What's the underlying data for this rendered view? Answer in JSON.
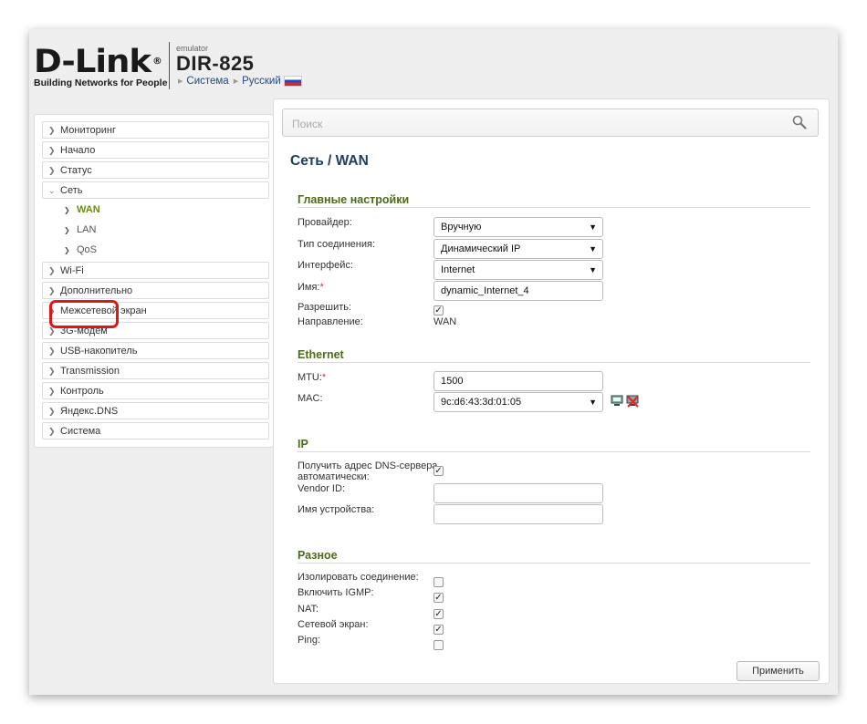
{
  "header": {
    "brand": "D-Link",
    "registered": "®",
    "tagline": "Building Networks for People",
    "emulator": "emulator",
    "model": "DIR-825",
    "crumb_system": "Система",
    "crumb_language": "Русский"
  },
  "sidebar": {
    "items": [
      {
        "label": "Мониторинг"
      },
      {
        "label": "Начало"
      },
      {
        "label": "Статус"
      },
      {
        "label": "Сеть"
      },
      {
        "label": "Wi-Fi"
      },
      {
        "label": "Дополнительно"
      },
      {
        "label": "Межсетевой экран"
      },
      {
        "label": "3G-модем"
      },
      {
        "label": "USB-накопитель"
      },
      {
        "label": "Transmission"
      },
      {
        "label": "Контроль"
      },
      {
        "label": "Яндекс.DNS"
      },
      {
        "label": "Система"
      }
    ],
    "sub_items": [
      {
        "label": "WAN"
      },
      {
        "label": "LAN"
      },
      {
        "label": "QoS"
      }
    ]
  },
  "search": {
    "placeholder": "Поиск"
  },
  "page": {
    "title": "Сеть /  WAN",
    "sections": {
      "main": "Главные настройки",
      "ethernet": "Ethernet",
      "ip": "IP",
      "misc": "Разное"
    },
    "main": {
      "provider_label": "Провайдер:",
      "provider_value": "Вручную",
      "conn_type_label": "Тип соединения:",
      "conn_type_value": "Динамический IP",
      "interface_label": "Интерфейс:",
      "interface_value": "Internet",
      "name_label": "Имя:",
      "name_value": "dynamic_Internet_4",
      "enable_label": "Разрешить:",
      "direction_label": "Направление:",
      "direction_value": "WAN"
    },
    "ethernet": {
      "mtu_label": "MTU:",
      "mtu_value": "1500",
      "mac_label": "MAC:",
      "mac_value": "9c:d6:43:3d:01:05"
    },
    "ip": {
      "dns_label_1": "Получить адрес DNS-сервера",
      "dns_label_2": "автоматически:",
      "vendor_label": "Vendor ID:",
      "vendor_value": "",
      "device_label": "Имя устройства:",
      "device_value": ""
    },
    "misc": {
      "isolate_label": "Изолировать соединение:",
      "igmp_label": "Включить IGMP:",
      "nat_label": "NAT:",
      "firewall_label": "Сетевой экран:",
      "ping_label": "Ping:"
    },
    "apply_label": "Применить",
    "required_mark": "*",
    "check_mark": "✓"
  },
  "checkboxes": {
    "enable": true,
    "dns_auto": true,
    "isolate": false,
    "igmp": true,
    "nat": true,
    "firewall": true,
    "ping": false
  },
  "colors": {
    "section_green": "#4c6b1a",
    "title_blue": "#1f3d66",
    "highlight_red": "#e01616",
    "active_green": "#6a8c1a"
  }
}
